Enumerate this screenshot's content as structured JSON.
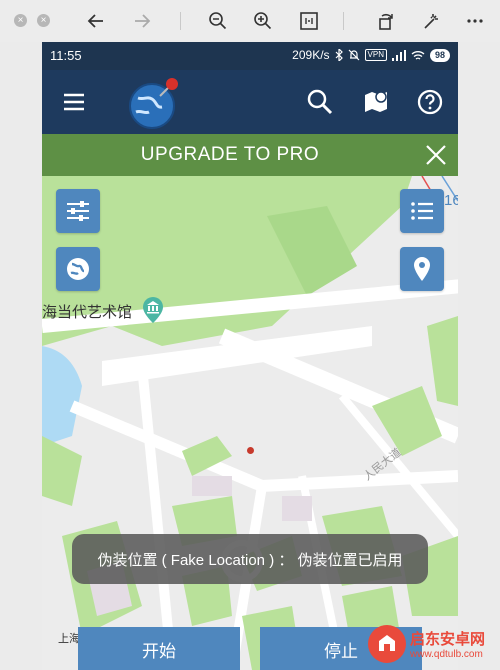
{
  "viewer": {
    "icons": [
      "close-dot",
      "minimize-dot",
      "back-arrow",
      "forward-arrow",
      "zoom-out",
      "zoom-in",
      "fit-page",
      "rotate",
      "magic-wand",
      "more"
    ]
  },
  "status_bar": {
    "time": "11:55",
    "speed": "209K/s",
    "vpn": "VPN",
    "battery": "98"
  },
  "app_bar": {
    "icons": [
      "menu-icon",
      "globe-pin-logo",
      "search-icon",
      "map-marker-icon",
      "help-icon"
    ]
  },
  "upgrade": {
    "text": "UPGRADE TO PRO",
    "close": "×"
  },
  "map": {
    "poi_museum": "海当代艺术馆",
    "poi_theatre": "上海大剧院",
    "road": "人民大道",
    "edge_number": "16",
    "colors": {
      "park": "#b9e19a",
      "road": "#ffffff",
      "water": "#aedaf4"
    }
  },
  "toast": {
    "text": "伪装位置 ( Fake Location ) ： 伪装位置已启用"
  },
  "buttons": {
    "start": "开始",
    "stop": "停止"
  },
  "watermark": {
    "line1": "启东安卓网",
    "line2": "www.qdtulb.com"
  }
}
